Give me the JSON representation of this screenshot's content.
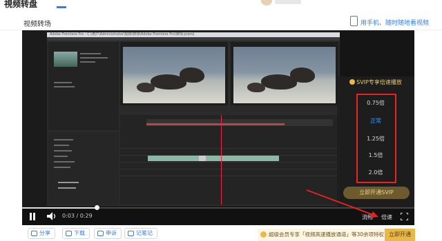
{
  "header": {
    "title": "視频转盘",
    "avatar": "user-avatar"
  },
  "page": {
    "title": "视频转场",
    "phone_link": "用手机、随时随地看视频"
  },
  "player": {
    "video_window_title": "Adobe Premiere Pro - C:\\用户\\Administrator\\视频\\转场\\Adobe Premiere Pro\\转场.prproj",
    "time_current": "0:03",
    "time_separator": "/",
    "time_total": "0:29",
    "progress": 0.19,
    "quality_label": "流畅",
    "speed_label": "倍速",
    "speed_tooltip": "倍速"
  },
  "speed_menu": {
    "header": "SVIP专享倍速播放",
    "options": [
      "0.75倍",
      "正常",
      "1.25倍",
      "1.5倍",
      "2.0倍"
    ],
    "selected": "正常",
    "button": "立即开通SVIP",
    "colors": {
      "active": "#2e9bff",
      "highlight_box": "#e22222",
      "gold": "#e8c776"
    }
  },
  "bottom_bar": {
    "buttons": [
      {
        "label": "分享",
        "icon": "share-icon"
      },
      {
        "label": "下载",
        "icon": "download-icon"
      },
      {
        "label": "申诉",
        "icon": "report-icon"
      },
      {
        "label": "记笔记",
        "icon": "note-icon"
      }
    ],
    "promo_text": "超级会员专享「视频高速播放通道」等30余项特权",
    "promo_button": "立即开通"
  }
}
